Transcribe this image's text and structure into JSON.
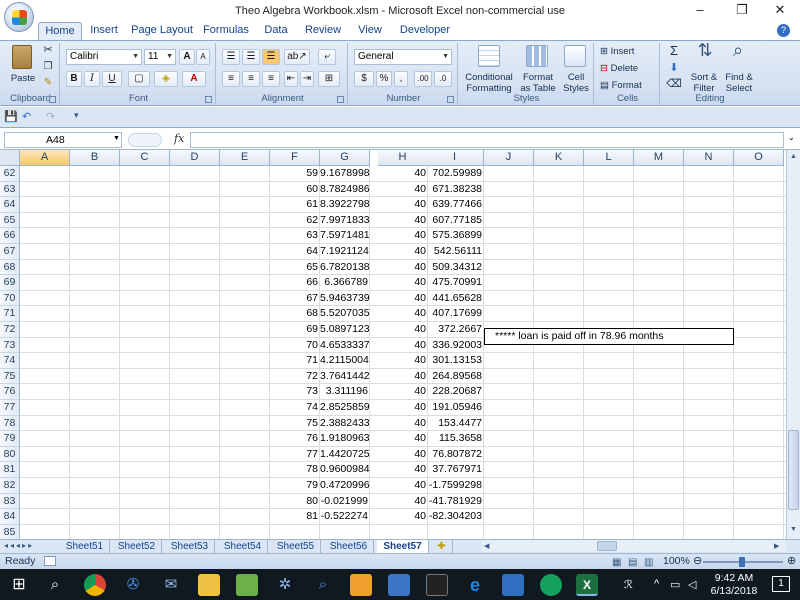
{
  "window": {
    "title": "Theo Algebra Workbook.xlsm - Microsoft Excel non-commercial use",
    "minimize": "–",
    "maximize": "❐",
    "close": "✕"
  },
  "ribbon_tabs": [
    "Home",
    "Insert",
    "Page Layout",
    "Formulas",
    "Data",
    "Review",
    "View",
    "Developer"
  ],
  "ribbon": {
    "clipboard": {
      "label": "Clipboard",
      "paste": "Paste"
    },
    "font": {
      "label": "Font",
      "name": "Calibri",
      "size": "11",
      "bold": "B",
      "italic": "I",
      "underline": "U",
      "grow": "A",
      "shrink": "A"
    },
    "alignment": {
      "label": "Alignment"
    },
    "number": {
      "label": "Number",
      "format": "General",
      "currency": "$",
      "percent": "%",
      "comma": ",",
      "inc_decimal": ".00",
      "dec_decimal": ".0"
    },
    "styles": {
      "label": "Styles",
      "conditional_1": "Conditional",
      "conditional_2": "Formatting",
      "format_table_1": "Format",
      "format_table_2": "as Table",
      "cell_styles_1": "Cell",
      "cell_styles_2": "Styles"
    },
    "cells": {
      "label": "Cells",
      "insert": "Insert",
      "delete": "Delete",
      "format": "Format"
    },
    "editing": {
      "label": "Editing",
      "sum": "Σ",
      "sort_1": "Sort &",
      "sort_2": "Filter",
      "find_1": "Find &",
      "find_2": "Select"
    }
  },
  "namebox": "A48",
  "formula": "",
  "fx": "fx",
  "columns": [
    "A",
    "B",
    "C",
    "D",
    "E",
    "F",
    "G",
    "H",
    "I",
    "J",
    "K",
    "L",
    "M",
    "N",
    "O"
  ],
  "rows": [
    {
      "n": "62",
      "F": "59",
      "G": "9.1678998",
      "H": "40",
      "I": "702.59989"
    },
    {
      "n": "63",
      "F": "60",
      "G": "8.7824986",
      "H": "40",
      "I": "671.38238"
    },
    {
      "n": "64",
      "F": "61",
      "G": "8.3922798",
      "H": "40",
      "I": "639.77466"
    },
    {
      "n": "65",
      "F": "62",
      "G": "7.9971833",
      "H": "40",
      "I": "607.77185"
    },
    {
      "n": "66",
      "F": "63",
      "G": "7.5971481",
      "H": "40",
      "I": "575.36899"
    },
    {
      "n": "67",
      "F": "64",
      "G": "7.1921124",
      "H": "40",
      "I": "542.56111"
    },
    {
      "n": "68",
      "F": "65",
      "G": "6.7820138",
      "H": "40",
      "I": "509.34312"
    },
    {
      "n": "69",
      "F": "66",
      "G": "6.366789",
      "H": "40",
      "I": "475.70991"
    },
    {
      "n": "70",
      "F": "67",
      "G": "5.9463739",
      "H": "40",
      "I": "441.65628"
    },
    {
      "n": "71",
      "F": "68",
      "G": "5.5207035",
      "H": "40",
      "I": "407.17699"
    },
    {
      "n": "72",
      "F": "69",
      "G": "5.0897123",
      "H": "40",
      "I": "372.2667"
    },
    {
      "n": "73",
      "F": "70",
      "G": "4.6533337",
      "H": "40",
      "I": "336.92003"
    },
    {
      "n": "74",
      "F": "71",
      "G": "4.2115004",
      "H": "40",
      "I": "301.13153"
    },
    {
      "n": "75",
      "F": "72",
      "G": "3.7641442",
      "H": "40",
      "I": "264.89568"
    },
    {
      "n": "76",
      "F": "73",
      "G": "3.311196",
      "H": "40",
      "I": "228.20687"
    },
    {
      "n": "77",
      "F": "74",
      "G": "2.8525859",
      "H": "40",
      "I": "191.05946"
    },
    {
      "n": "78",
      "F": "75",
      "G": "2.3882433",
      "H": "40",
      "I": "153.4477"
    },
    {
      "n": "79",
      "F": "76",
      "G": "1.9180963",
      "H": "40",
      "I": "115.3658"
    },
    {
      "n": "80",
      "F": "77",
      "G": "1.4420725",
      "H": "40",
      "I": "76.807872"
    },
    {
      "n": "81",
      "F": "78",
      "G": "0.9600984",
      "H": "40",
      "I": "37.767971"
    },
    {
      "n": "82",
      "F": "79",
      "G": "0.4720996",
      "H": "40",
      "I": "-1.7599298"
    },
    {
      "n": "83",
      "F": "80",
      "G": "-0.021999",
      "H": "40",
      "I": "-41.781929"
    },
    {
      "n": "84",
      "F": "81",
      "G": "-0.522274",
      "H": "40",
      "I": "-82.304203"
    },
    {
      "n": "85",
      "F": "",
      "G": "",
      "H": "",
      "I": ""
    }
  ],
  "note": "***** loan is paid off in 78.96 months",
  "sheets": [
    "Sheet51",
    "Sheet52",
    "Sheet53",
    "Sheet54",
    "Sheet55",
    "Sheet56",
    "Sheet57"
  ],
  "active_sheet": "Sheet57",
  "status": {
    "ready": "Ready",
    "zoom": "100%"
  },
  "taskbar": {
    "time": "9:42 AM",
    "date": "6/13/2018",
    "notifications": "1"
  }
}
